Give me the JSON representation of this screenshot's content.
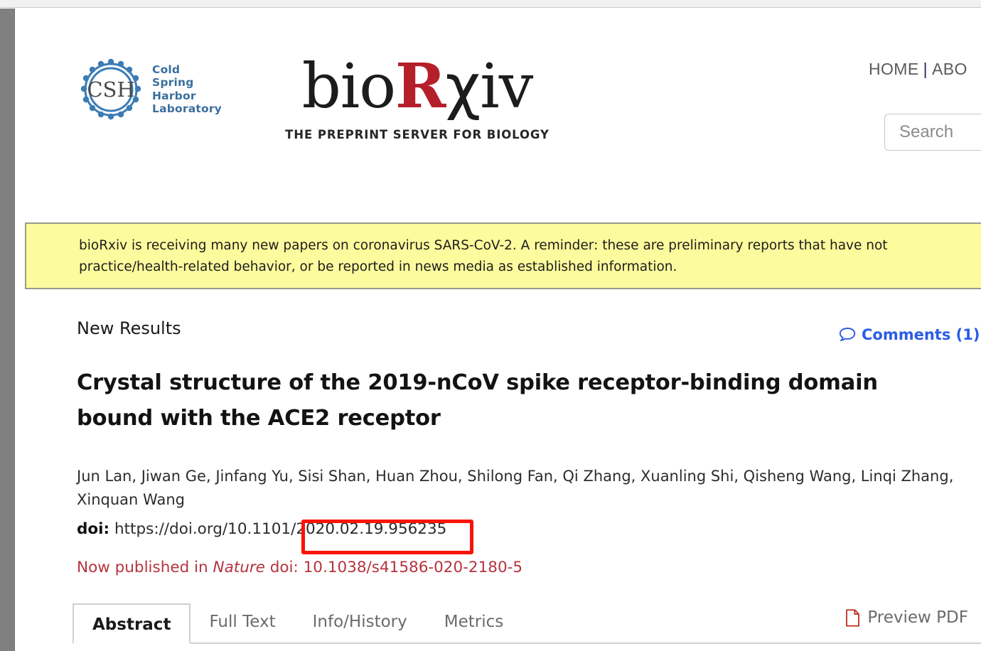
{
  "browser": {
    "top_strip_color": "#f1f1f1",
    "gutter_color": "#808080"
  },
  "masthead": {
    "csh_logo": {
      "mark_text": "CSH",
      "line1": "Cold",
      "line2": "Spring",
      "line3": "Harbor",
      "line4": "Laboratory",
      "color": "#3b6f9e"
    },
    "brand": {
      "prefix": "bio",
      "accent": "R",
      "chi": "χ",
      "suffix": "iv",
      "accent_color": "#b51f2a",
      "tagline": "THE PREPRINT SERVER FOR BIOLOGY"
    },
    "nav": {
      "home": "HOME",
      "separator": "|",
      "about": "ABO"
    },
    "search": {
      "placeholder": "Search",
      "value": ""
    }
  },
  "alert": {
    "line1": "bioRxiv is receiving many new papers on coronavirus SARS-CoV-2. A reminder: these are preliminary reports that have not",
    "line2": "practice/health-related behavior, or be reported in news media as established information.",
    "background": "#fcfb9d"
  },
  "article": {
    "result_kind": "New Results",
    "comments_label": "Comments (1)",
    "comments_color": "#2b5ce6",
    "title": "Crystal structure of the 2019-nCoV spike receptor-binding domain bound with the ACE2 receptor",
    "authors": "Jun Lan, Jiwan Ge, Jinfang Yu, Sisi Shan, Huan Zhou, Shilong Fan, Qi Zhang, Xuanling Shi, Qisheng Wang, Linqi Zhang, Xinquan Wang",
    "doi": {
      "label": "doi:",
      "prefix": "https://doi.org/10.1101/",
      "highlighted": "2020.02.19.956235",
      "highlight_color": "#fc1205"
    },
    "published": {
      "prefix": "Now published in",
      "journal": "Nature",
      "doi_label": "doi:",
      "doi_value": "10.1038/s41586-020-2180-5",
      "color": "#b5333e"
    }
  },
  "tabs": [
    {
      "label": "Abstract",
      "active": true
    },
    {
      "label": "Full Text",
      "active": false
    },
    {
      "label": "Info/History",
      "active": false
    },
    {
      "label": "Metrics",
      "active": false
    }
  ],
  "preview_pdf": {
    "label": "Preview PDF",
    "icon_color": "#c0392b"
  }
}
